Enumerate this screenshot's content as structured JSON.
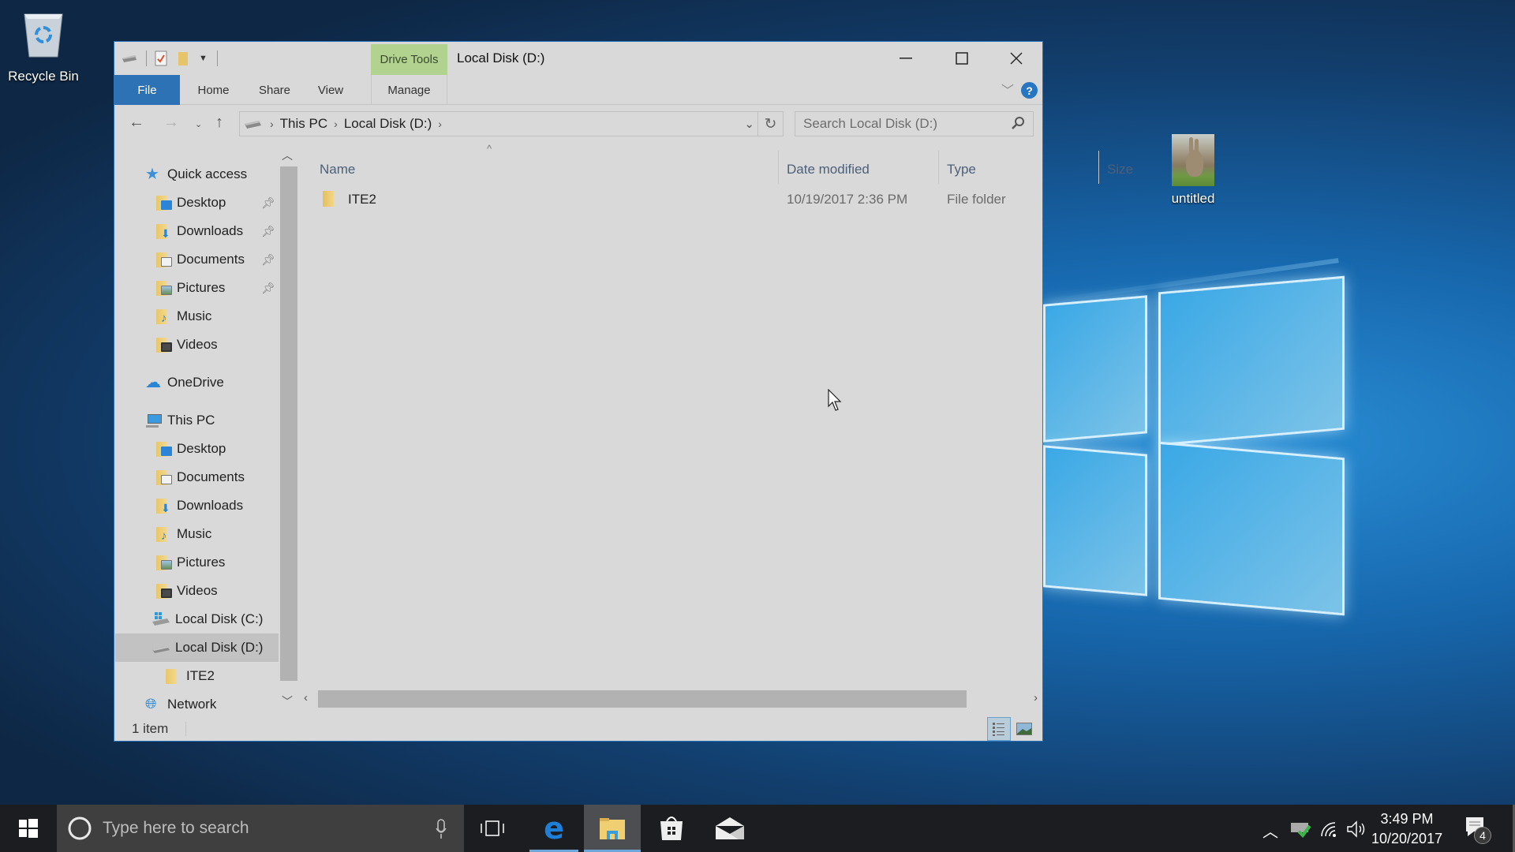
{
  "desktop": {
    "icons": [
      {
        "label": "Recycle Bin",
        "icon": "recycle-bin-icon"
      },
      {
        "label": "untitled",
        "icon": "image-thumbnail-icon"
      }
    ]
  },
  "window": {
    "title": "Local Disk (D:)",
    "contextual_tab_group": "Drive Tools",
    "quick_access_toolbar": [
      "drive-icon",
      "properties-icon",
      "new-folder-icon",
      "customize-dropdown-icon"
    ],
    "controls": {
      "minimize": "minimize-icon",
      "maximize": "maximize-icon",
      "close": "close-icon"
    },
    "ribbon_tabs": [
      {
        "label": "File",
        "active": true
      },
      {
        "label": "Home"
      },
      {
        "label": "Share"
      },
      {
        "label": "View"
      },
      {
        "label": "Manage"
      }
    ],
    "help_label": "?",
    "address": {
      "segments": [
        "This PC",
        "Local Disk (D:)"
      ],
      "search_placeholder": "Search Local Disk (D:)"
    },
    "sidebar": {
      "quick_access": {
        "label": "Quick access",
        "items": [
          {
            "label": "Desktop",
            "pinned": true
          },
          {
            "label": "Downloads",
            "pinned": true
          },
          {
            "label": "Documents",
            "pinned": true
          },
          {
            "label": "Pictures",
            "pinned": true
          },
          {
            "label": "Music"
          },
          {
            "label": "Videos"
          }
        ]
      },
      "onedrive": "OneDrive",
      "this_pc": {
        "label": "This PC",
        "items": [
          "Desktop",
          "Documents",
          "Downloads",
          "Music",
          "Pictures",
          "Videos",
          "Local Disk (C:)",
          "Local Disk (D:)",
          "ITE2"
        ]
      },
      "network": "Network",
      "selected": "Local Disk (D:)"
    },
    "columns": [
      "Name",
      "Date modified",
      "Type",
      "Size"
    ],
    "files": [
      {
        "name": "ITE2",
        "date_modified": "10/19/2017 2:36 PM",
        "type": "File folder",
        "size": ""
      }
    ],
    "status": "1 item"
  },
  "taskbar": {
    "search_placeholder": "Type here to search",
    "apps": [
      "task-view-icon",
      "edge-icon",
      "file-explorer-icon",
      "store-icon",
      "mail-icon"
    ],
    "active_app": "file-explorer-icon",
    "tray": [
      "show-hidden-icons",
      "network-drive-icon",
      "wifi-icon",
      "volume-icon"
    ],
    "time": "3:49 PM",
    "date": "10/20/2017",
    "notification_count": "4"
  }
}
